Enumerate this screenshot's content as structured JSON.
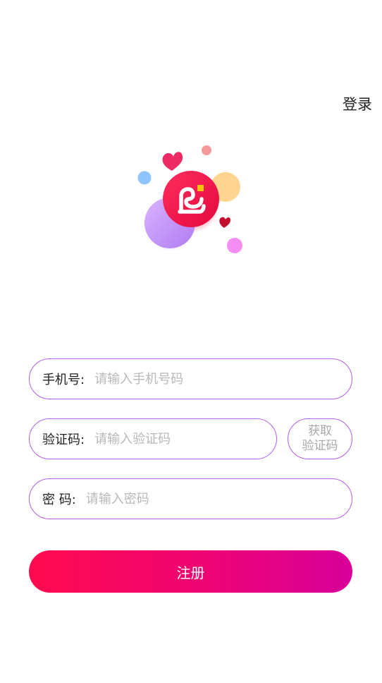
{
  "header": {
    "login_label": "登录"
  },
  "logo": {
    "icon": "app-logo-icon",
    "colors": {
      "primary": "#f0134d",
      "accent": "#ffc107"
    }
  },
  "form": {
    "phone": {
      "label": "手机号:",
      "placeholder": "请输入手机号码",
      "value": ""
    },
    "code": {
      "label": "验证码:",
      "placeholder": "请输入验证码",
      "value": "",
      "button_line1": "获取",
      "button_line2": "验证码"
    },
    "password": {
      "label": "密 码:",
      "placeholder": "请输入密码",
      "value": ""
    }
  },
  "register": {
    "label": "注册",
    "gradient": [
      "#ff0a4f",
      "#d8009a"
    ]
  },
  "colors": {
    "field_border": "#b65ce3",
    "placeholder": "#b8b8b8"
  }
}
